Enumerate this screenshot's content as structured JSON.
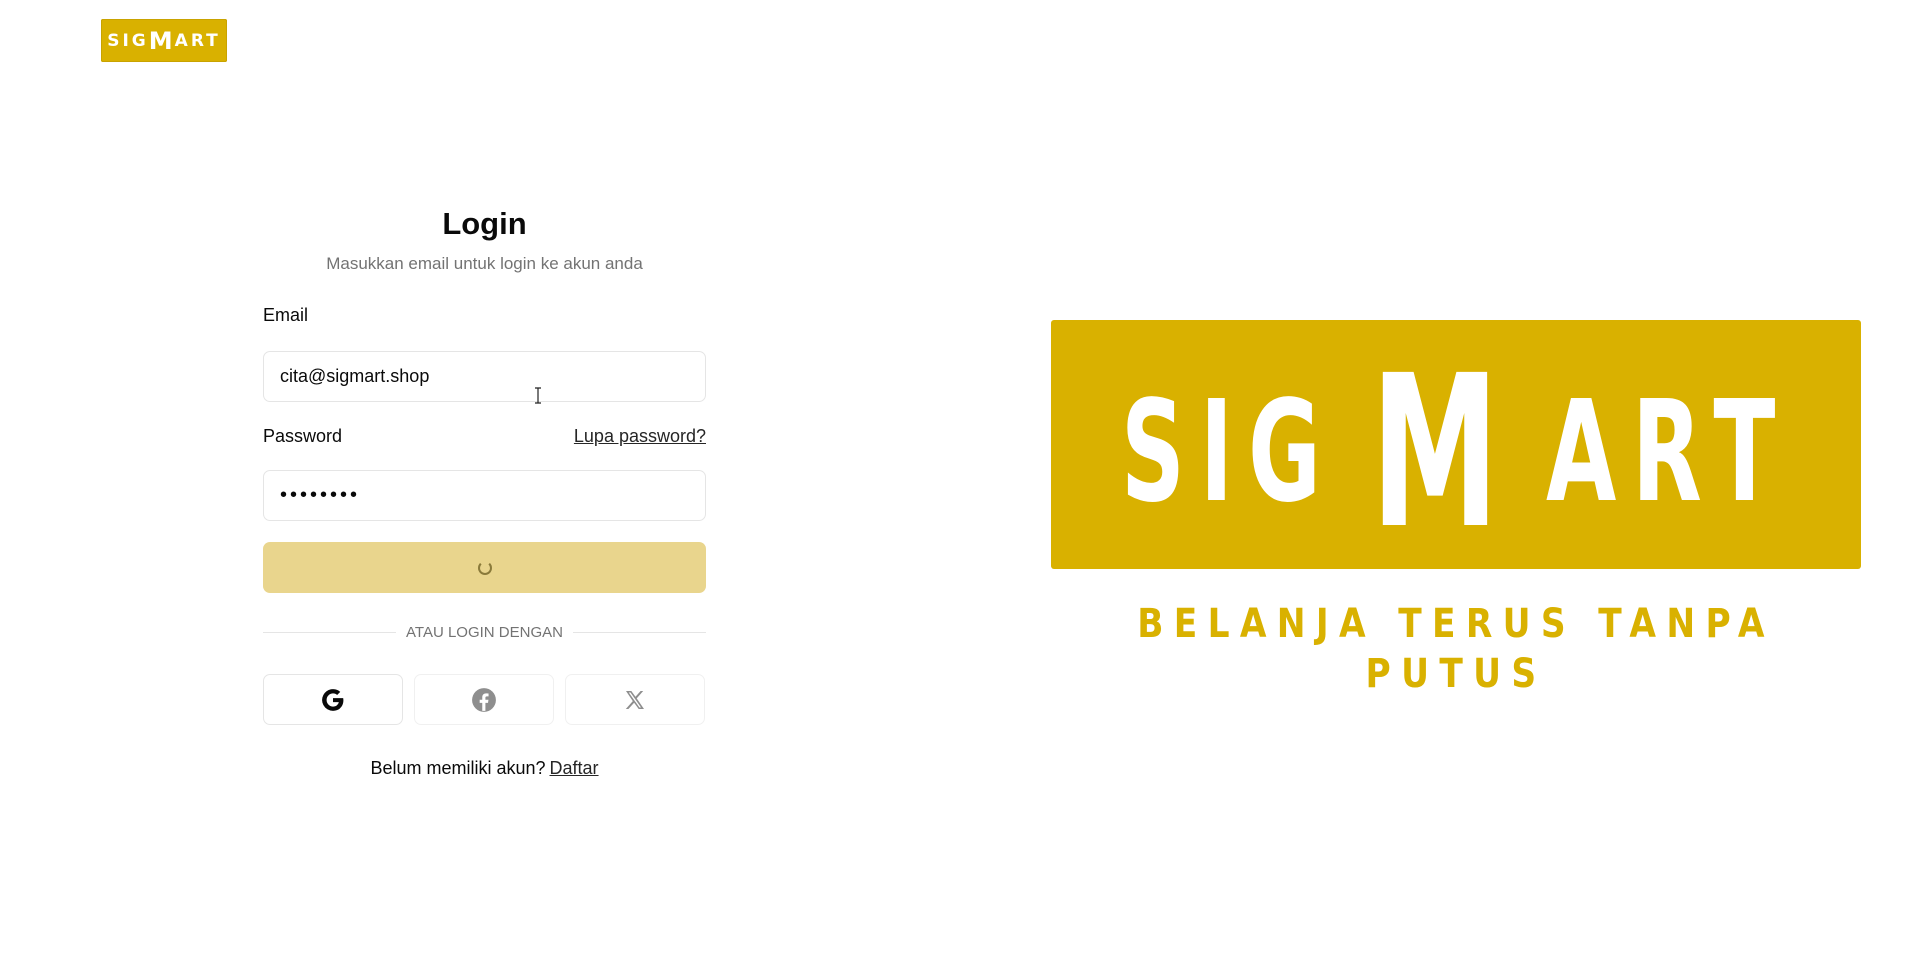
{
  "header": {
    "logo": {
      "prefix": "SIG",
      "big": "M",
      "suffix": "ART"
    }
  },
  "login": {
    "title": "Login",
    "subtitle": "Masukkan email untuk login ke akun anda",
    "email_label": "Email",
    "email_value": "cita@sigmart.shop",
    "password_label": "Password",
    "forgot_label": "Lupa password?",
    "password_value": "••••••••",
    "submit_state": "loading",
    "divider_text": "Atau login dengan",
    "social": {
      "google_icon": "google-icon",
      "facebook_icon": "facebook-icon",
      "x_icon": "x-icon"
    },
    "signup_prompt": "Belum memiliki akun?",
    "signup_link": "Daftar"
  },
  "hero": {
    "logo": {
      "prefix": "SIG",
      "big": "M",
      "suffix": "ART"
    },
    "tagline": "BELANJA TERUS TANPA PUTUS"
  },
  "colors": {
    "brand": "#d9b100",
    "button_disabled": "#e9d58d",
    "muted_text": "#737373",
    "border": "#e5e5e5"
  }
}
